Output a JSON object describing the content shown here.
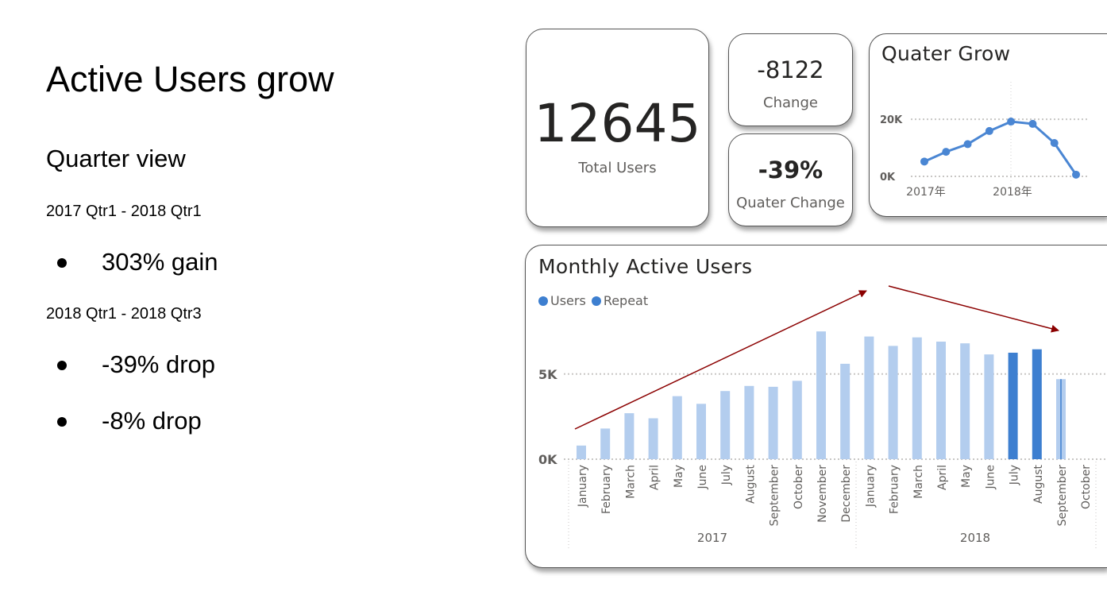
{
  "slide": {
    "title": "Active Users grow",
    "subtitle": "Quarter view",
    "range1": "2017 Qtr1 - 2018 Qtr1",
    "bullet1": "303% gain",
    "range2": "2018 Qtr1 - 2018 Qtr3",
    "bullet2": "-39% drop",
    "bullet3": "-8% drop"
  },
  "kpis": {
    "total_users": {
      "value": "12645",
      "label": "Total Users"
    },
    "change": {
      "value": "-8122",
      "label": "Change"
    },
    "quarter_change": {
      "value": "-39%",
      "label": "Quater Change"
    }
  },
  "colors": {
    "bar_light": "#b3cdee",
    "bar_dark": "#3d7fd0",
    "line": "#4a86d3",
    "arrow": "#8b0000",
    "axis_text": "#605e5c"
  },
  "chart_data": [
    {
      "type": "line",
      "title": "Quater Grow",
      "x_ticks": [
        "2017年",
        "2018年"
      ],
      "y_ticks": [
        "0K",
        "20K"
      ],
      "ylim": [
        0,
        22000
      ],
      "values": [
        5200,
        8600,
        11300,
        15900,
        19200,
        18400,
        11700,
        600
      ],
      "grid": true
    },
    {
      "type": "bar",
      "title": "Monthly Active Users",
      "legend": [
        "Users",
        "Repeat"
      ],
      "legend_position": "top-left",
      "y_ticks": [
        "0K",
        "5K"
      ],
      "ylim": [
        0,
        7600
      ],
      "categories": [
        "January",
        "February",
        "March",
        "April",
        "May",
        "June",
        "July",
        "August",
        "September",
        "October",
        "November",
        "December",
        "January",
        "February",
        "March",
        "April",
        "May",
        "June",
        "July",
        "August",
        "September",
        "October"
      ],
      "years": [
        "2017",
        "2018"
      ],
      "series": [
        {
          "name": "Users",
          "values": [
            800,
            1800,
            2700,
            2400,
            3700,
            3250,
            4000,
            4300,
            4250,
            4600,
            7500,
            5600,
            7200,
            6650,
            7150,
            6900,
            6800,
            6150,
            6250,
            6450,
            4700,
            0
          ]
        }
      ],
      "highlighted": [
        false,
        false,
        false,
        false,
        false,
        false,
        false,
        false,
        false,
        false,
        false,
        false,
        false,
        false,
        false,
        false,
        false,
        false,
        true,
        true,
        false,
        false
      ],
      "grid": true
    }
  ]
}
